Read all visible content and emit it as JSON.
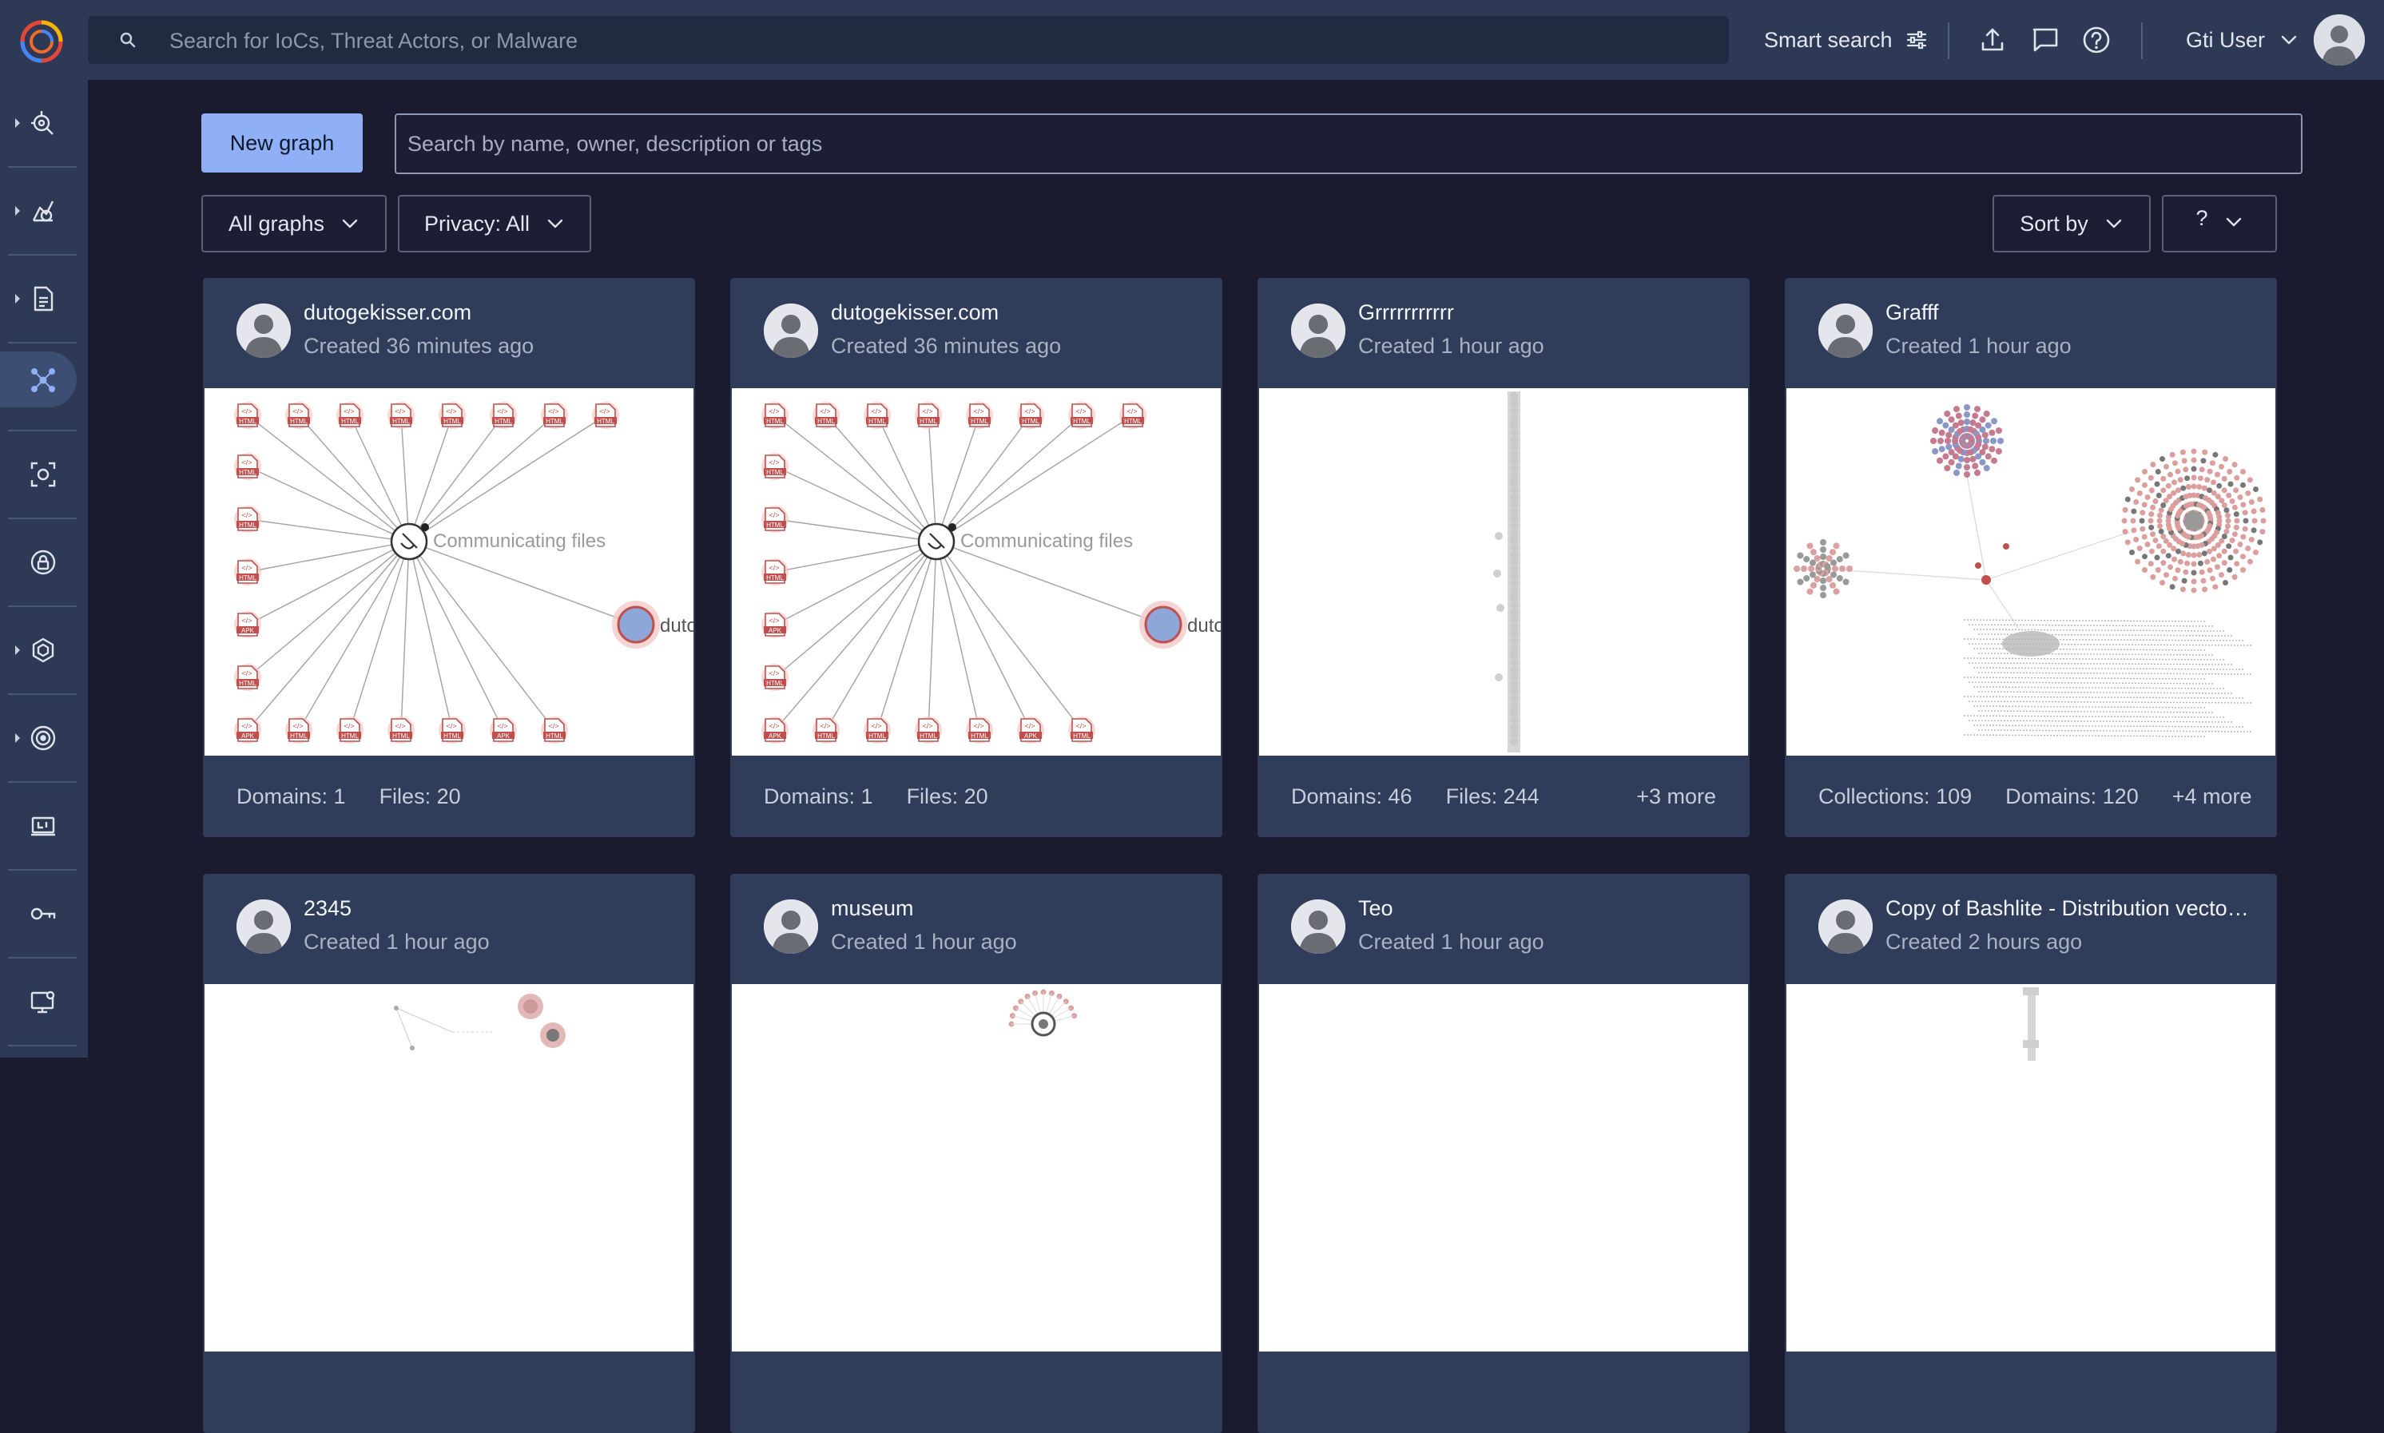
{
  "search": {
    "placeholder": "Search for IoCs, Threat Actors, or Malware"
  },
  "smart_search": {
    "label": "Smart search"
  },
  "user": {
    "name": "Gti User"
  },
  "toolbar": {
    "new_graph_label": "New graph",
    "graph_search_placeholder": "Search by name, owner, description or tags"
  },
  "filters": {
    "all_graphs": "All graphs",
    "privacy": "Privacy: All",
    "sort_by": "Sort by",
    "help": "?"
  },
  "sidebar": {
    "items": [
      {
        "icon": "threat-hunt-icon",
        "has_caret": true
      },
      {
        "icon": "threat-actor-icon",
        "has_caret": true
      },
      {
        "icon": "reports-icon",
        "has_caret": true
      },
      {
        "icon": "graph-icon",
        "has_caret": false,
        "active": true
      },
      {
        "icon": "scan-icon",
        "has_caret": false
      },
      {
        "icon": "lock-icon",
        "has_caret": false
      },
      {
        "icon": "hexagon-icon",
        "has_caret": true
      },
      {
        "icon": "radar-icon",
        "has_caret": true
      },
      {
        "icon": "terminal-icon",
        "has_caret": false
      },
      {
        "icon": "key-icon",
        "has_caret": false
      },
      {
        "icon": "monitor-icon",
        "has_caret": false
      }
    ]
  },
  "cards": [
    {
      "title": "dutogekisser.com",
      "created": "Created 36 minutes ago",
      "preview": "star",
      "star_label": "Communicating files",
      "domain_label": "duto",
      "stats": [
        "Domains: 1",
        "Files: 20"
      ],
      "more": ""
    },
    {
      "title": "dutogekisser.com",
      "created": "Created 36 minutes ago",
      "preview": "star",
      "star_label": "Communicating files",
      "domain_label": "duto",
      "stats": [
        "Domains: 1",
        "Files: 20"
      ],
      "more": ""
    },
    {
      "title": "Grrrrrrrrrrr",
      "created": "Created 1 hour ago",
      "preview": "column",
      "stats": [
        "Domains: 46",
        "Files: 244"
      ],
      "more": "+3 more"
    },
    {
      "title": "Grafff",
      "created": "Created 1 hour ago",
      "preview": "clusters",
      "stats": [
        "Collections: 109",
        "Domains: 120"
      ],
      "more": "+4 more"
    },
    {
      "title": "2345",
      "created": "Created 1 hour ago",
      "preview": "small",
      "stats": [],
      "more": ""
    },
    {
      "title": "museum",
      "created": "Created 1 hour ago",
      "preview": "ring",
      "stats": [],
      "more": ""
    },
    {
      "title": "Teo",
      "created": "Created 1 hour ago",
      "preview": "blank",
      "stats": [],
      "more": ""
    },
    {
      "title": "Copy of Bashlite - Distribution vecto…",
      "created": "Created 2 hours ago",
      "preview": "bar",
      "stats": [],
      "more": ""
    }
  ]
}
